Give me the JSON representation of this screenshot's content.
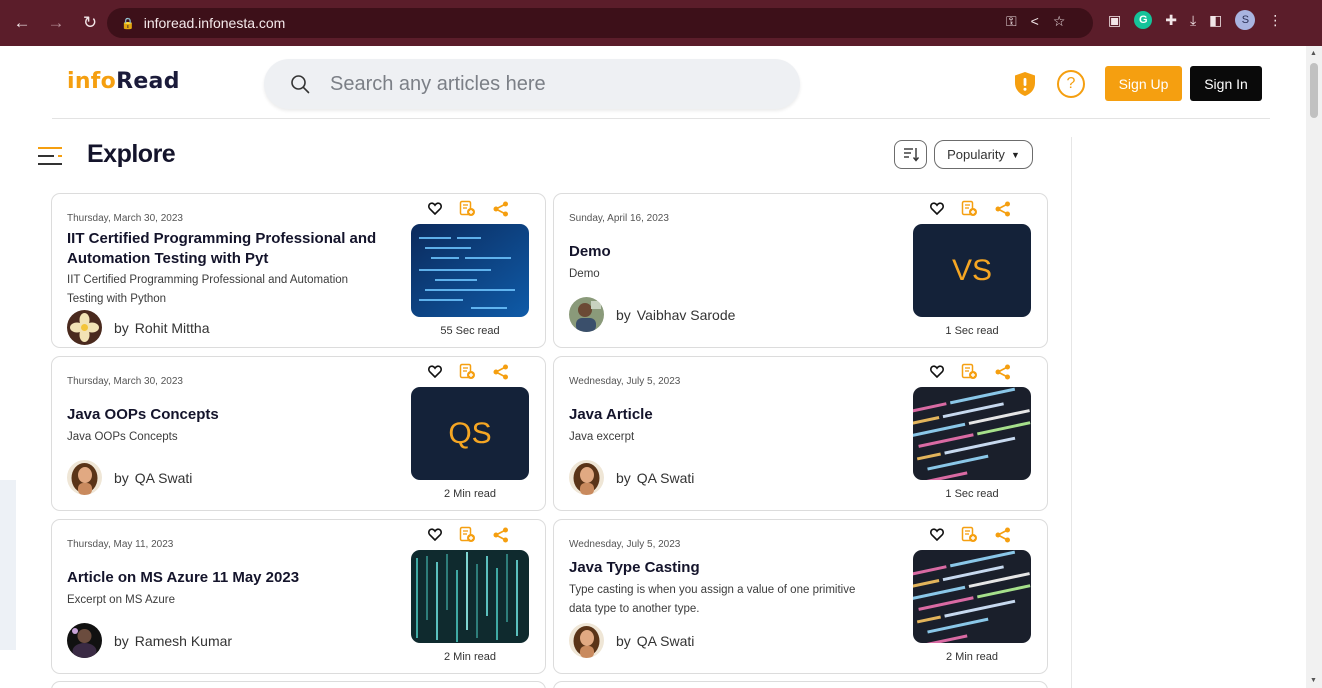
{
  "browser": {
    "url": "inforead.infonesta.com",
    "profile_initial": "S",
    "grammarly": "G"
  },
  "header": {
    "logo_part1": "info",
    "logo_part2": "Read",
    "search_placeholder": "Search any articles here",
    "help_glyph": "?",
    "signup_label": "Sign Up",
    "signin_label": "Sign In"
  },
  "explore": {
    "title": "Explore",
    "sort_selected": "Popularity"
  },
  "articles": [
    {
      "date": "Thursday, March 30, 2023",
      "title": "IIT Certified Programming Professional and Automation Testing with Pyt",
      "excerpt": "IIT Certified Programming Professional and Automation Testing with Python",
      "by": "by",
      "author": "Rohit Mittha",
      "read_time": "55 Sec read",
      "thumb_text": ""
    },
    {
      "date": "Sunday, April 16, 2023",
      "title": "Demo",
      "excerpt": "Demo",
      "by": "by",
      "author": "Vaibhav Sarode",
      "read_time": "1 Sec read",
      "thumb_text": "VS"
    },
    {
      "date": "Thursday, March 30, 2023",
      "title": "Java OOPs Concepts",
      "excerpt": "Java OOPs Concepts",
      "by": "by",
      "author": "QA Swati",
      "read_time": "2 Min read",
      "thumb_text": "QS"
    },
    {
      "date": "Wednesday, July 5, 2023",
      "title": "Java Article",
      "excerpt": "Java excerpt",
      "by": "by",
      "author": "QA Swati",
      "read_time": "1 Sec read",
      "thumb_text": ""
    },
    {
      "date": "Thursday, May 11, 2023",
      "title": "Article on MS Azure 11 May 2023",
      "excerpt": "Excerpt on MS Azure",
      "by": "by",
      "author": "Ramesh Kumar",
      "read_time": "2 Min read",
      "thumb_text": ""
    },
    {
      "date": "Wednesday, July 5, 2023",
      "title": "Java Type Casting",
      "excerpt": "Type casting is when you assign a value of one primitive data type to another type.",
      "by": "by",
      "author": "QA Swati",
      "read_time": "2 Min read",
      "thumb_text": ""
    }
  ],
  "colors": {
    "brand_orange": "#f59f10",
    "brand_dark": "#1b1b3a",
    "chrome_bg": "#5b1d2a",
    "thumb_bg": "#142239"
  }
}
